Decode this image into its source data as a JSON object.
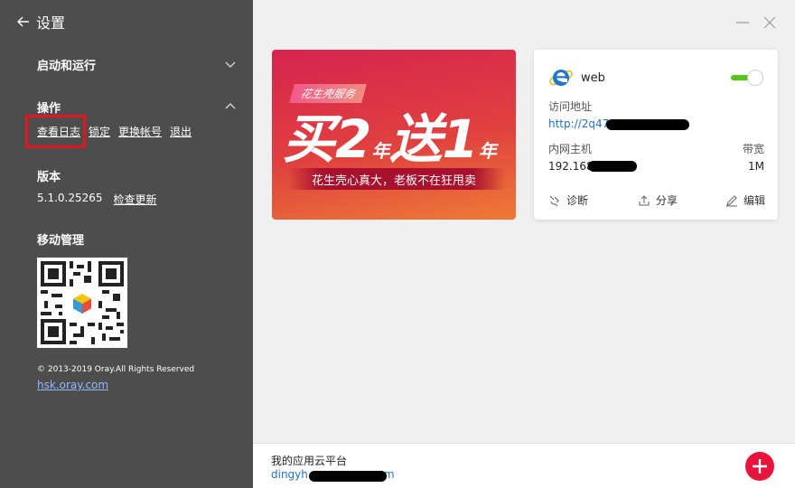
{
  "sidebar": {
    "back_title": "设置",
    "startup": {
      "title": "启动和运行"
    },
    "operations": {
      "title": "操作",
      "links": [
        "查看日志",
        "锁定",
        "更换帐号",
        "退出"
      ]
    },
    "version": {
      "title": "版本",
      "number": "5.1.0.25265",
      "check_update": "检查更新"
    },
    "mobile": {
      "title": "移动管理"
    },
    "copyright": "© 2013-2019 Oray.All Rights Reserved",
    "site": "hsk.oray.com"
  },
  "promo": {
    "tag": "花生壳服务",
    "headline_a": "买2",
    "unit_a": "年",
    "headline_b": "送1",
    "unit_b": "年",
    "subtitle": "花生壳心真大，老板不在狂甩卖"
  },
  "service_card": {
    "name": "web",
    "enabled": true,
    "access_label": "访问地址",
    "access_url_partial": "http://2q47",
    "host_label": "内网主机",
    "host_partial": "192.168",
    "bandwidth_label": "带宽",
    "bandwidth": "1M",
    "actions": {
      "diagnose": "诊断",
      "share": "分享",
      "edit": "编辑"
    }
  },
  "footer": {
    "title": "我的应用云平台",
    "account_start": "dingyh",
    "account_end": "m"
  },
  "colors": {
    "sidebar_bg": "#4d4d4d",
    "highlight": "#e8141b",
    "toggle_on": "#52c41a",
    "link": "#1e6fc7",
    "add_button": "#e8143c"
  }
}
